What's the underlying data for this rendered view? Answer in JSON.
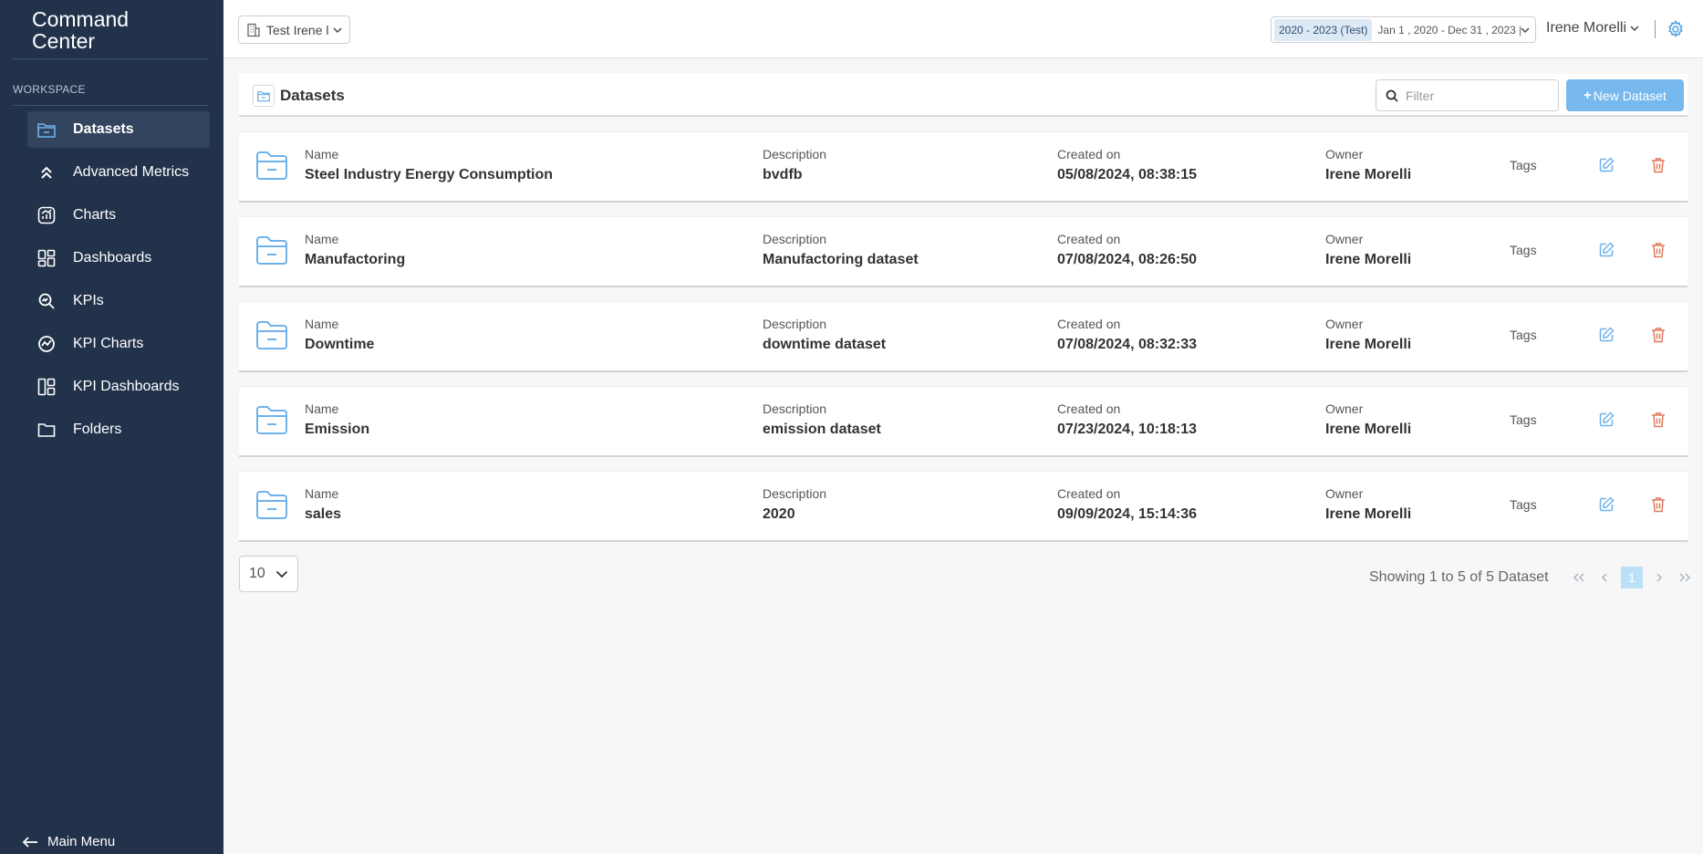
{
  "sidebar": {
    "brand_line1": "Command",
    "brand_line2": "Center",
    "section_label": "WORKSPACE",
    "items": [
      {
        "label": "Datasets",
        "icon": "dataset-folder-icon",
        "active": true
      },
      {
        "label": "Advanced Metrics",
        "icon": "double-chevron-up-icon"
      },
      {
        "label": "Charts",
        "icon": "chart-icon"
      },
      {
        "label": "Dashboards",
        "icon": "dashboard-grid-icon"
      },
      {
        "label": "KPIs",
        "icon": "kpi-search-icon"
      },
      {
        "label": "KPI Charts",
        "icon": "kpi-chart-icon"
      },
      {
        "label": "KPI Dashboards",
        "icon": "kpi-dashboard-icon"
      },
      {
        "label": "Folders",
        "icon": "folder-icon"
      }
    ],
    "main_menu": "Main Menu"
  },
  "topbar": {
    "workspace_select": "Test Irene l",
    "date_badge": "2020 - 2023 (Test)",
    "date_range": "Jan 1 , 2020 - Dec 31 , 2023 |",
    "user_name": "Irene Morelli"
  },
  "datasets": {
    "title": "Datasets",
    "filter_placeholder": "Filter",
    "new_button": "New Dataset",
    "labels": {
      "name": "Name",
      "description": "Description",
      "created": "Created on",
      "owner": "Owner",
      "tags": "Tags"
    },
    "rows": [
      {
        "name": "Steel Industry Energy Consumption",
        "description": "bvdfb",
        "created": "05/08/2024, 08:38:15",
        "owner": "Irene Morelli"
      },
      {
        "name": "Manufactoring",
        "description": "Manufactoring dataset",
        "created": "07/08/2024, 08:26:50",
        "owner": "Irene Morelli"
      },
      {
        "name": "Downtime",
        "description": "downtime dataset",
        "created": "07/08/2024, 08:32:33",
        "owner": "Irene Morelli"
      },
      {
        "name": "Emission",
        "description": "emission dataset",
        "created": "07/23/2024, 10:18:13",
        "owner": "Irene Morelli"
      },
      {
        "name": "sales",
        "description": "2020",
        "created": "09/09/2024, 15:14:36",
        "owner": "Irene Morelli"
      }
    ]
  },
  "footer": {
    "page_size": "10",
    "showing": "Showing 1 to 5 of 5 Dataset",
    "current_page": "1"
  },
  "colors": {
    "sidebar_bg": "#22324b",
    "accent": "#77b8ee",
    "delete": "#e07a5f"
  }
}
